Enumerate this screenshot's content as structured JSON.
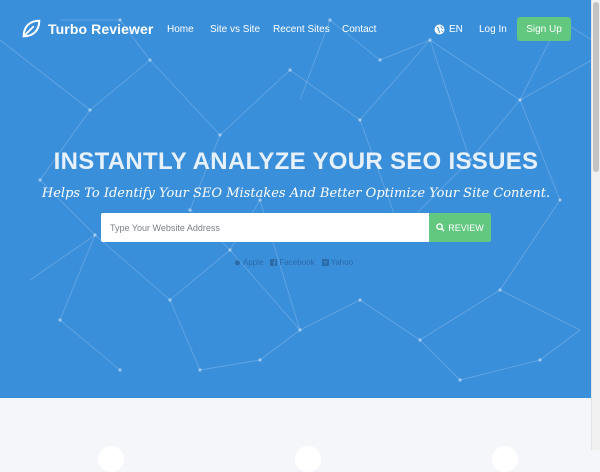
{
  "brand": {
    "name": "Turbo Reviewer"
  },
  "nav": {
    "links": [
      "Home",
      "Site vs Site",
      "Recent Sites",
      "Contact"
    ],
    "language": "EN",
    "login": "Log In",
    "signup": "Sign Up"
  },
  "hero": {
    "headline": "INSTANTLY ANALYZE YOUR SEO ISSUES",
    "subheadline": "Helps To Identify Your SEO Mistakes And Better Optimize Your Site Content.",
    "search": {
      "placeholder": "Type Your Website Address",
      "value": ""
    },
    "review_button": "REVIEW",
    "extensions": [
      "Apple",
      "Facebook",
      "Yahoo"
    ]
  },
  "colors": {
    "hero_bg": "#3a8fdb",
    "accent_green": "#62c77f",
    "lower_bg": "#f4f6f9"
  },
  "icons": [
    "leaf-logo-icon",
    "globe-icon",
    "search-icon",
    "apple-icon",
    "facebook-icon",
    "yahoo-icon"
  ]
}
